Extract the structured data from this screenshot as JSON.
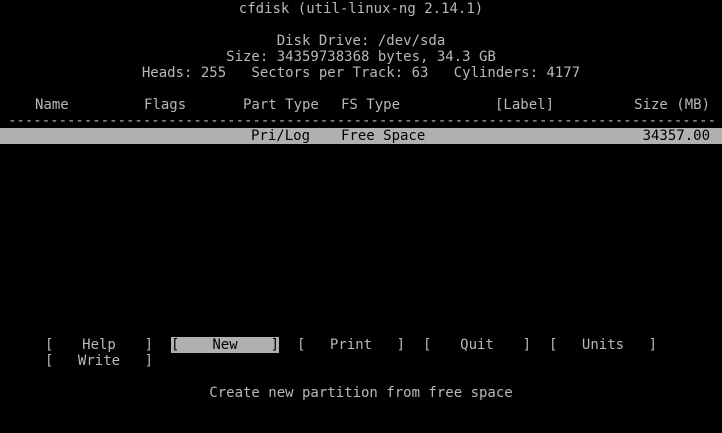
{
  "header": {
    "title": "cfdisk (util-linux-ng 2.14.1)",
    "disk_drive": "Disk Drive: /dev/sda",
    "disk_size": "Size: 34359738368 bytes, 34.3 GB",
    "geometry": "Heads: 255   Sectors per Track: 63   Cylinders: 4177"
  },
  "table": {
    "columns": {
      "name": "Name",
      "flags": "Flags",
      "part_type": "Part Type",
      "fs_type": "FS Type",
      "label": "[Label]",
      "size": "Size (MB)"
    },
    "separator": "------------------------------------------------------------------------------------------------------------",
    "rows": [
      {
        "name": "",
        "flags": "",
        "part_type": "Pri/Log",
        "fs_type": "Free Space",
        "label": "",
        "size": "34357.00"
      }
    ]
  },
  "menu": {
    "left_bracket": "[",
    "right_bracket": "]",
    "items": [
      {
        "label": "Help"
      },
      {
        "label": "New",
        "selected": true
      },
      {
        "label": "Print"
      },
      {
        "label": "Quit"
      },
      {
        "label": "Units"
      },
      {
        "label": "Write"
      }
    ]
  },
  "status": "Create new partition from free space",
  "colors": {
    "background": "#000000",
    "foreground": "#b8b8b8",
    "highlight": "#b0b0b0"
  }
}
